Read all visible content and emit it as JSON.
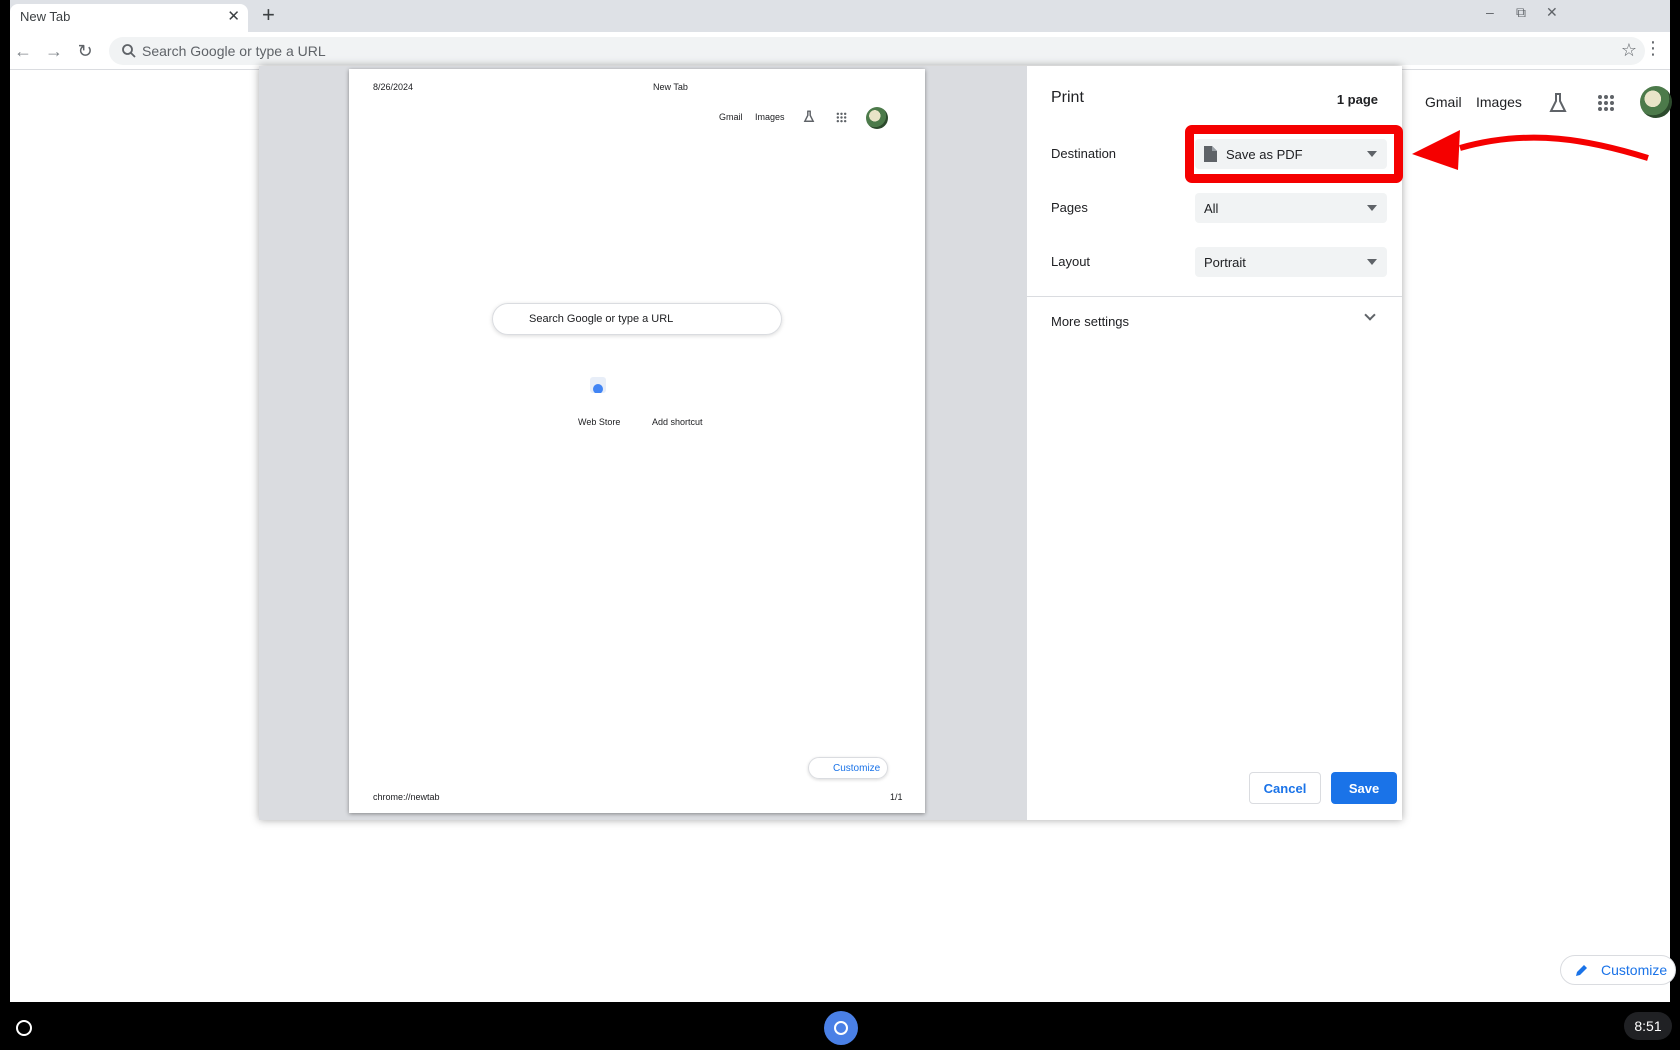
{
  "browser": {
    "tab_title": "New Tab",
    "tab_close": "✕",
    "new_tab": "+",
    "omnibox_placeholder": "Search Google or type a URL",
    "win_min": "–",
    "win_max": "⧉",
    "win_close": "✕"
  },
  "ntp": {
    "gmail": "Gmail",
    "images": "Images",
    "customize": "Customize"
  },
  "preview": {
    "date": "8/26/2024",
    "page_title": "New Tab",
    "gmail": "Gmail",
    "images": "Images",
    "search_placeholder": "Search Google or type a URL",
    "web_store": "Web Store",
    "add_shortcut": "Add shortcut",
    "customize": "Customize",
    "url": "chrome://newtab",
    "page_num": "1/1"
  },
  "print": {
    "title": "Print",
    "page_count": "1 page",
    "destination_label": "Destination",
    "destination_value": "Save as PDF",
    "pages_label": "Pages",
    "pages_value": "All",
    "layout_label": "Layout",
    "layout_value": "Portrait",
    "more_settings": "More settings",
    "cancel": "Cancel",
    "save": "Save"
  },
  "annotation": {
    "highlight_color": "#f50000"
  },
  "shelf": {
    "time": "8:51"
  }
}
